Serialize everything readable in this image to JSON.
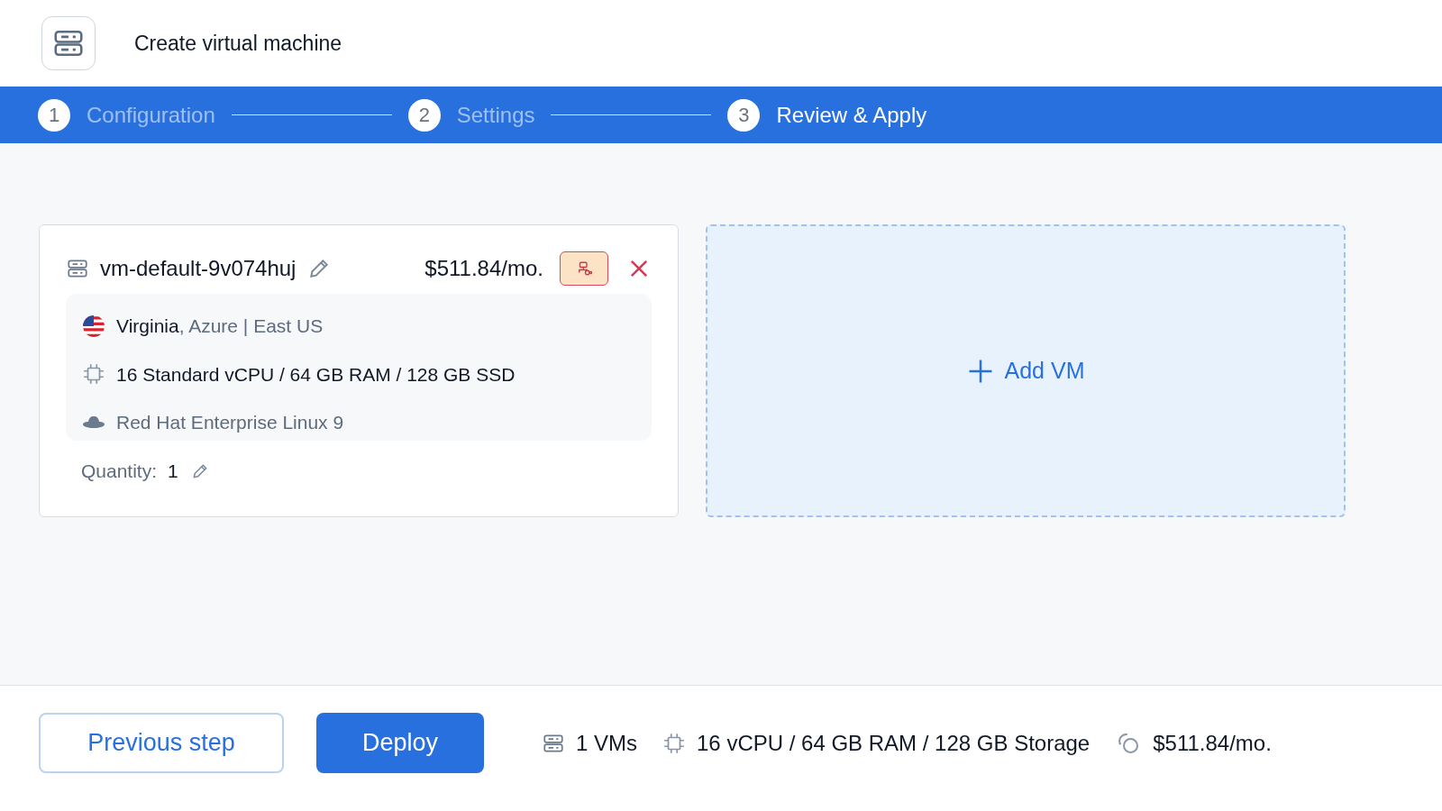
{
  "header": {
    "title": "Create virtual machine"
  },
  "steps": [
    {
      "number": "1",
      "label": "Configuration",
      "selected": false
    },
    {
      "number": "2",
      "label": "Settings",
      "selected": false
    },
    {
      "number": "3",
      "label": "Review & Apply",
      "selected": true
    }
  ],
  "vm_card": {
    "name": "vm-default-9v074huj",
    "price": "$511.84/mo.",
    "location": "**Virginia**, Azure | East US",
    "specs": "16 Standard vCPU / 64 GB RAM / 128 GB SSD",
    "os": "Red Hat Enterprise Linux 9",
    "quantity_label": "Quantity:",
    "quantity": "1"
  },
  "add_vm": {
    "label": "Add VM"
  },
  "footer": {
    "previous": "Previous step",
    "deploy": "Deploy",
    "vms": "1 VMs",
    "resources": "16 vCPU / 64 GB RAM / 128 GB Storage",
    "total": "$511.84/mo."
  }
}
